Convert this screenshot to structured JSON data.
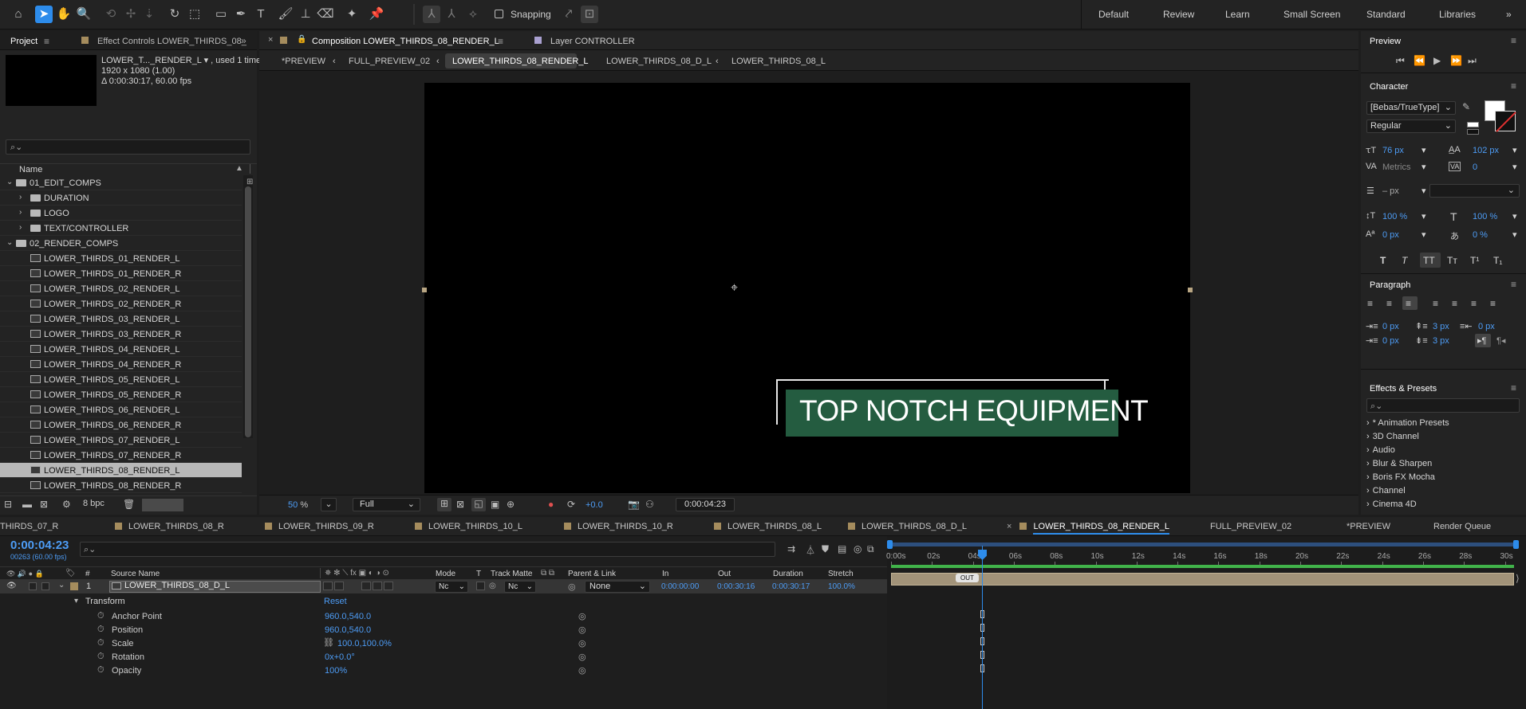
{
  "toolbar": {
    "snapping_label": "Snapping",
    "workspaces": [
      "Default",
      "Review",
      "Learn",
      "Small Screen",
      "Standard",
      "Libraries"
    ]
  },
  "project": {
    "tab_label": "Project",
    "effect_controls_label": "Effect Controls LOWER_THIRDS_08_",
    "thumb_name": "LOWER_T..._RENDER_L",
    "thumb_used": ", used 1 time",
    "thumb_dims": "1920 x 1080 (1.00)",
    "thumb_duration": "Δ 0:00:30:17, 60.00 fps",
    "col_name": "Name",
    "bpc": "8 bpc",
    "items": [
      {
        "label": "01_EDIT_COMPS",
        "kind": "folder",
        "level": 0,
        "open": true
      },
      {
        "label": "DURATION",
        "kind": "folder",
        "level": 1,
        "open": false
      },
      {
        "label": "LOGO",
        "kind": "folder",
        "level": 1,
        "open": false
      },
      {
        "label": "TEXT/CONTROLLER",
        "kind": "folder",
        "level": 1,
        "open": false
      },
      {
        "label": "02_RENDER_COMPS",
        "kind": "folder",
        "level": 0,
        "open": true
      },
      {
        "label": "LOWER_THIRDS_01_RENDER_L",
        "kind": "comp",
        "level": 1
      },
      {
        "label": "LOWER_THIRDS_01_RENDER_R",
        "kind": "comp",
        "level": 1
      },
      {
        "label": "LOWER_THIRDS_02_RENDER_L",
        "kind": "comp",
        "level": 1
      },
      {
        "label": "LOWER_THIRDS_02_RENDER_R",
        "kind": "comp",
        "level": 1
      },
      {
        "label": "LOWER_THIRDS_03_RENDER_L",
        "kind": "comp",
        "level": 1
      },
      {
        "label": "LOWER_THIRDS_03_RENDER_R",
        "kind": "comp",
        "level": 1
      },
      {
        "label": "LOWER_THIRDS_04_RENDER_L",
        "kind": "comp",
        "level": 1
      },
      {
        "label": "LOWER_THIRDS_04_RENDER_R",
        "kind": "comp",
        "level": 1
      },
      {
        "label": "LOWER_THIRDS_05_RENDER_L",
        "kind": "comp",
        "level": 1
      },
      {
        "label": "LOWER_THIRDS_05_RENDER_R",
        "kind": "comp",
        "level": 1
      },
      {
        "label": "LOWER_THIRDS_06_RENDER_L",
        "kind": "comp",
        "level": 1
      },
      {
        "label": "LOWER_THIRDS_06_RENDER_R",
        "kind": "comp",
        "level": 1
      },
      {
        "label": "LOWER_THIRDS_07_RENDER_L",
        "kind": "comp",
        "level": 1
      },
      {
        "label": "LOWER_THIRDS_07_RENDER_R",
        "kind": "comp",
        "level": 1
      },
      {
        "label": "LOWER_THIRDS_08_RENDER_L",
        "kind": "comp",
        "level": 1,
        "selected": true
      },
      {
        "label": "LOWER_THIRDS_08_RENDER_R",
        "kind": "comp",
        "level": 1
      }
    ]
  },
  "composition": {
    "tab_label": "Composition LOWER_THIRDS_08_RENDER_L",
    "layer_tab": "Layer CONTROLLER",
    "crumbs": [
      "*PREVIEW",
      "FULL_PREVIEW_02",
      "LOWER_THIRDS_08_RENDER_L",
      "LOWER_THIRDS_08_D_L",
      "LOWER_THIRDS_08_L"
    ],
    "lower_third_text": "TOP NOTCH EQUIPMENT",
    "zoom": "50",
    "zoom_unit": "%",
    "resolution": "Full",
    "exposure": "+0.0",
    "timecode": "0:00:04:23"
  },
  "preview": {
    "title": "Preview"
  },
  "character": {
    "title": "Character",
    "font": "[Bebas/TrueType]",
    "style": "Regular",
    "size": "76 px",
    "leading": "102 px",
    "kerning": "Metrics",
    "tracking": "0",
    "stroke": "– px",
    "vscale": "100 %",
    "hscale": "100 %",
    "baseline": "0 px",
    "tsume": "0 %"
  },
  "paragraph": {
    "title": "Paragraph",
    "indent_left": "0 px",
    "space_before": "3 px",
    "indent_right": "0 px",
    "first_indent": "0 px",
    "space_after": "3 px"
  },
  "effects": {
    "title": "Effects & Presets",
    "items": [
      "* Animation Presets",
      "3D Channel",
      "Audio",
      "Blur & Sharpen",
      "Boris FX Mocha",
      "Channel",
      "Cinema 4D"
    ]
  },
  "timeline": {
    "tabs": [
      "THIRDS_07_R",
      "LOWER_THIRDS_08_R",
      "LOWER_THIRDS_09_R",
      "LOWER_THIRDS_10_L",
      "LOWER_THIRDS_10_R",
      "LOWER_THIRDS_08_L",
      "LOWER_THIRDS_08_D_L",
      "LOWER_THIRDS_08_RENDER_L",
      "FULL_PREVIEW_02",
      "*PREVIEW",
      "Render Queue"
    ],
    "timecode": "0:00:04:23",
    "frames": "00263 (60.00 fps)",
    "cols": {
      "num": "#",
      "source": "Source Name",
      "mode": "Mode",
      "t": "T",
      "matte": "Track Matte",
      "parent": "Parent & Link",
      "in": "In",
      "out": "Out",
      "duration": "Duration",
      "stretch": "Stretch"
    },
    "layer": {
      "num": "1",
      "name": "LOWER_THIRDS_08_D_L",
      "mode": "Nc",
      "matte": "Nc",
      "parent": "None",
      "in": "0:00:00:00",
      "out": "0:00:30:16",
      "duration": "0:00:30:17",
      "stretch": "100.0%"
    },
    "transform": {
      "label": "Transform",
      "reset": "Reset",
      "props": [
        {
          "name": "Anchor Point",
          "value": "960.0,540.0"
        },
        {
          "name": "Position",
          "value": "960.0,540.0"
        },
        {
          "name": "Scale",
          "value": "100.0,100.0%"
        },
        {
          "name": "Rotation",
          "value": "0x+0.0°"
        },
        {
          "name": "Opacity",
          "value": "100%"
        }
      ]
    },
    "ruler": [
      "0:00s",
      "02s",
      "04s",
      "06s",
      "08s",
      "10s",
      "12s",
      "14s",
      "16s",
      "18s",
      "20s",
      "22s",
      "24s",
      "26s",
      "28s",
      "30s"
    ],
    "out_label": "OUT"
  },
  "colors": {
    "accent": "#2d8ceb",
    "lower_third_green": "#245c40",
    "layer_bar": "#a29379",
    "work_area": "#41b34a"
  }
}
